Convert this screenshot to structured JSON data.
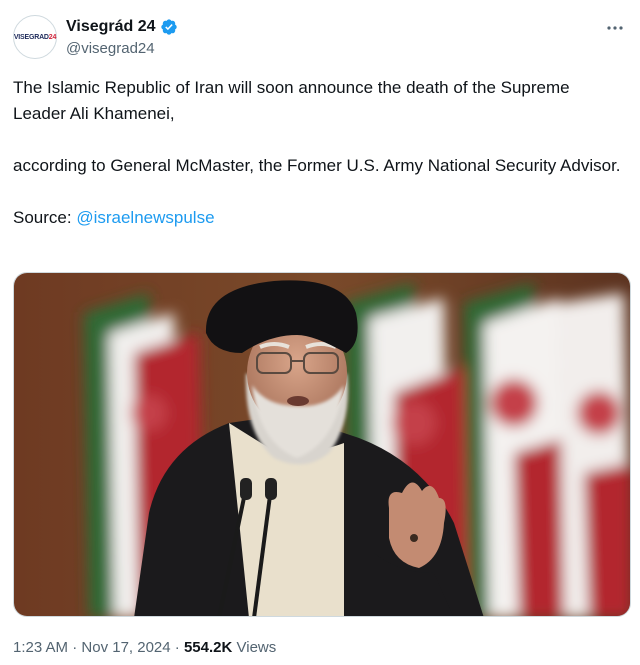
{
  "author": {
    "display_name": "Visegrád 24",
    "handle": "@visegrad24",
    "avatar_text_main": "VISEGRAD",
    "avatar_text_accent": "24",
    "verified": true
  },
  "tweet": {
    "line1": "The Islamic Republic of Iran will soon announce the death of the Supreme Leader Ali Khamenei,",
    "line2": "according to General McMaster, the Former U.S. Army National Security Advisor.",
    "source_label": "Source: ",
    "source_link": "@israelnewspulse"
  },
  "meta": {
    "time": "1:23 AM",
    "separator1": " · ",
    "date": "Nov 17, 2024",
    "separator2": " · ",
    "views_count": "554.2K",
    "views_label": " Views"
  },
  "icons": {
    "verified": "verified-badge-icon",
    "more": "more-options-icon"
  },
  "colors": {
    "link": "#1d9bf0",
    "secondary_text": "#536471",
    "verified": "#1d9bf0"
  }
}
